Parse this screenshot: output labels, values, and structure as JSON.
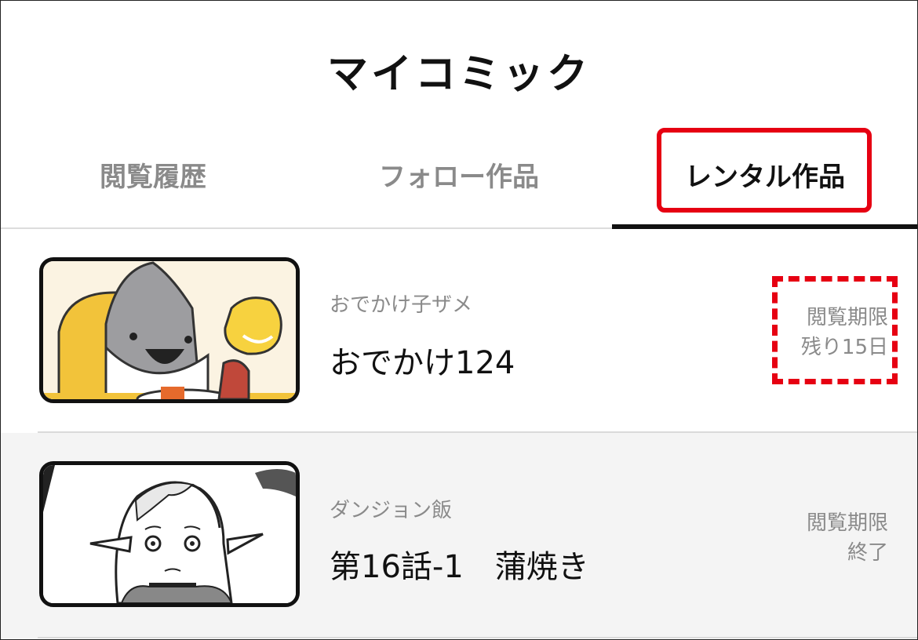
{
  "header": {
    "title": "マイコミック"
  },
  "tabs": [
    {
      "label": "閲覧履歴",
      "active": false
    },
    {
      "label": "フォロー作品",
      "active": false
    },
    {
      "label": "レンタル作品",
      "active": true
    }
  ],
  "items": [
    {
      "series": "おでかけ子ザメ",
      "episode": "おでかけ124",
      "deadline_line1": "閲覧期限",
      "deadline_line2": "残り15日",
      "thumb_icon": "shark-comic-thumbnail"
    },
    {
      "series": "ダンジョン飯",
      "episode": "第16話-1　蒲焼き",
      "deadline_line1": "閲覧期限",
      "deadline_line2": "終了",
      "thumb_icon": "elf-comic-thumbnail"
    }
  ],
  "colors": {
    "accent": "#e60012",
    "text": "#111111",
    "muted": "#8a8a8a",
    "row_alt": "#f4f4f4"
  }
}
